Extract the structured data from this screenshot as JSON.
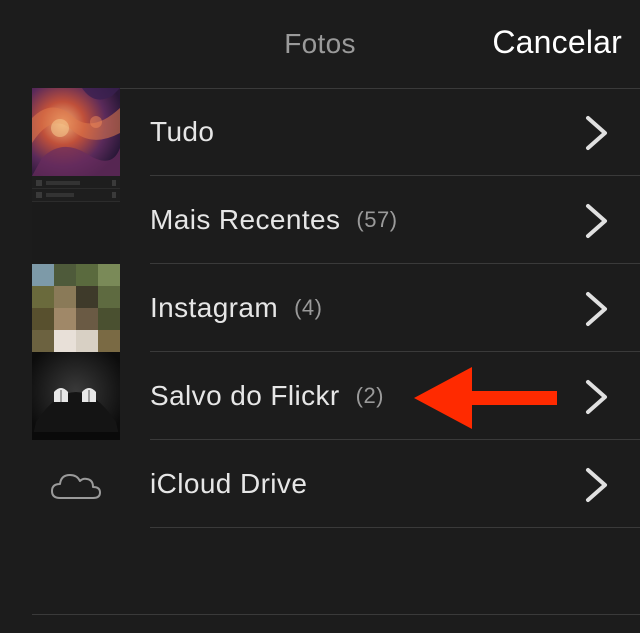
{
  "navbar": {
    "title": "Fotos",
    "cancel_label": "Cancelar"
  },
  "albums": [
    {
      "label": "Tudo",
      "count": "",
      "thumb": "nebula-thumbnail"
    },
    {
      "label": "Mais Recentes",
      "count": "(57)",
      "thumb": "screenshot-thumbnail"
    },
    {
      "label": "Instagram",
      "count": "(4)",
      "thumb": "pixelated-photo-thumbnail"
    },
    {
      "label": "Salvo do Flickr",
      "count": "(2)",
      "thumb": "dark-windows-thumbnail"
    },
    {
      "label": "iCloud Drive",
      "count": "",
      "thumb": "cloud-icon"
    }
  ],
  "colors": {
    "background": "#1c1c1c",
    "separator": "#3a3a3a",
    "label": "#e6e6e6",
    "secondary": "#9a9a9a",
    "annotation_arrow": "#ff2a00"
  }
}
